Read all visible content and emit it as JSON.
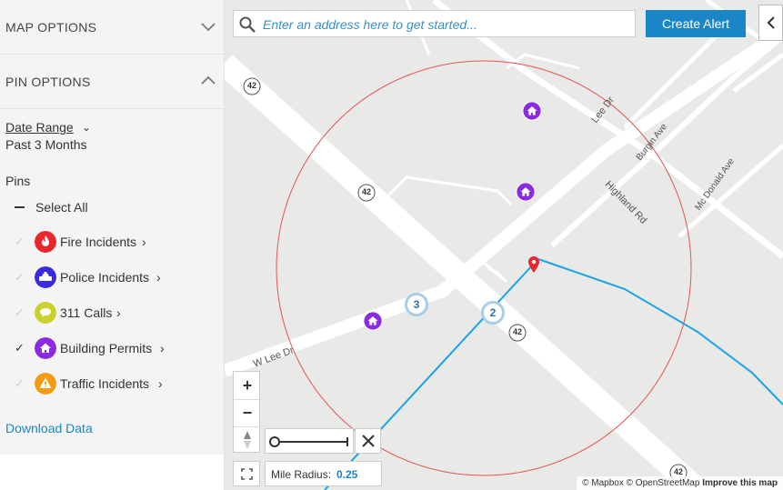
{
  "sidebar": {
    "map_options_title": "MAP OPTIONS",
    "pin_options_title": "PIN OPTIONS",
    "date_range_label": "Date Range",
    "date_range_value": "Past 3 Months",
    "pins_label": "Pins",
    "select_all_label": "Select All",
    "pins": [
      {
        "label": "Fire Incidents",
        "checked": false,
        "color": "#e8262b",
        "icon": "fire-icon"
      },
      {
        "label": "Police Incidents",
        "checked": false,
        "color": "#3a2be0",
        "icon": "police-car-icon"
      },
      {
        "label": "311 Calls",
        "checked": false,
        "color": "#c9d12a",
        "icon": "speech-bubble-icon"
      },
      {
        "label": "Building Permits",
        "checked": true,
        "color": "#8a2be2",
        "icon": "house-icon"
      },
      {
        "label": "Traffic Incidents",
        "checked": false,
        "color": "#f39c12",
        "icon": "warning-icon"
      }
    ],
    "download_label": "Download Data"
  },
  "map": {
    "search_placeholder": "Enter an address here to get started...",
    "create_alert_label": "Create Alert",
    "zoom_in_label": "+",
    "zoom_out_label": "−",
    "mile_radius_label": "Mile Radius:",
    "mile_radius_value": "0.25",
    "cluster_counts": [
      "3",
      "2"
    ],
    "route_shields": [
      "42",
      "42",
      "42",
      "42"
    ],
    "street_labels": [
      "Lee Dr",
      "Burgin Ave",
      "Highland Rd",
      "Mc Donald Ave",
      "W Lee Dr"
    ],
    "attribution": {
      "mapbox": "© Mapbox",
      "osm": "© OpenStreetMap",
      "improve": "Improve this map"
    },
    "colors": {
      "accent": "#1a86c8",
      "radius_circle": "#e05555",
      "route_line": "#1aa3e8",
      "marker": "#e8262b"
    }
  }
}
